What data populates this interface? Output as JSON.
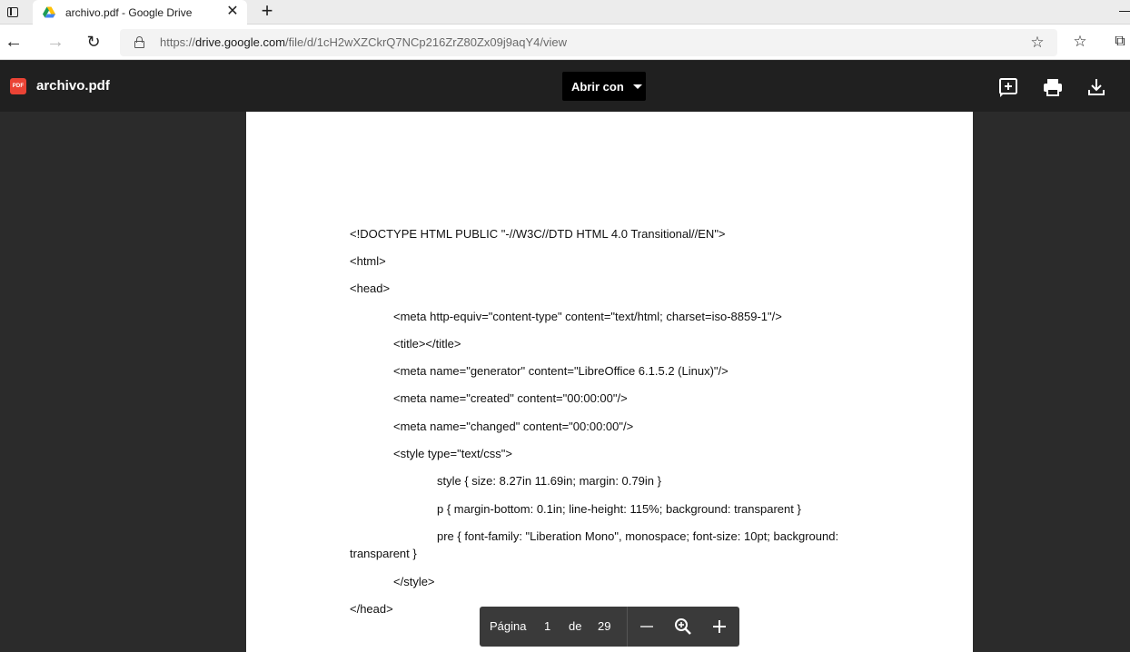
{
  "browser": {
    "tab_title": "archivo.pdf - Google Drive",
    "url_prefix": "https://",
    "url_host": "drive.google.com",
    "url_path": "/file/d/1cH2wXZCkrQ7NCp216ZrZ80Zx09j9aqY4/view"
  },
  "viewer": {
    "file_name": "archivo.pdf",
    "pdf_badge": "PDF",
    "open_with_label": "Abrir con"
  },
  "document": {
    "lines": [
      "<!DOCTYPE HTML PUBLIC \"-//W3C//DTD HTML 4.0 Transitional//EN\">",
      "<html>",
      "<head>",
      "<meta http-equiv=\"content-type\" content=\"text/html; charset=iso-8859-1\"/>",
      "<title></title>",
      "<meta name=\"generator\" content=\"LibreOffice 6.1.5.2 (Linux)\"/>",
      "<meta name=\"created\" content=\"00:00:00\"/>",
      "<meta name=\"changed\" content=\"00:00:00\"/>",
      "<style type=\"text/css\">",
      "style { size: 8.27in 11.69in; margin: 0.79in }",
      "p { margin-bottom: 0.1in; line-height: 115%; background: transparent }",
      "pre { font-family: \"Liberation Mono\", monospace; font-size: 10pt; background:",
      "transparent }",
      "</style>",
      "</head>"
    ]
  },
  "page_toolbar": {
    "page_label": "Página",
    "current_page": "1",
    "of_label": "de",
    "total_pages": "29"
  }
}
